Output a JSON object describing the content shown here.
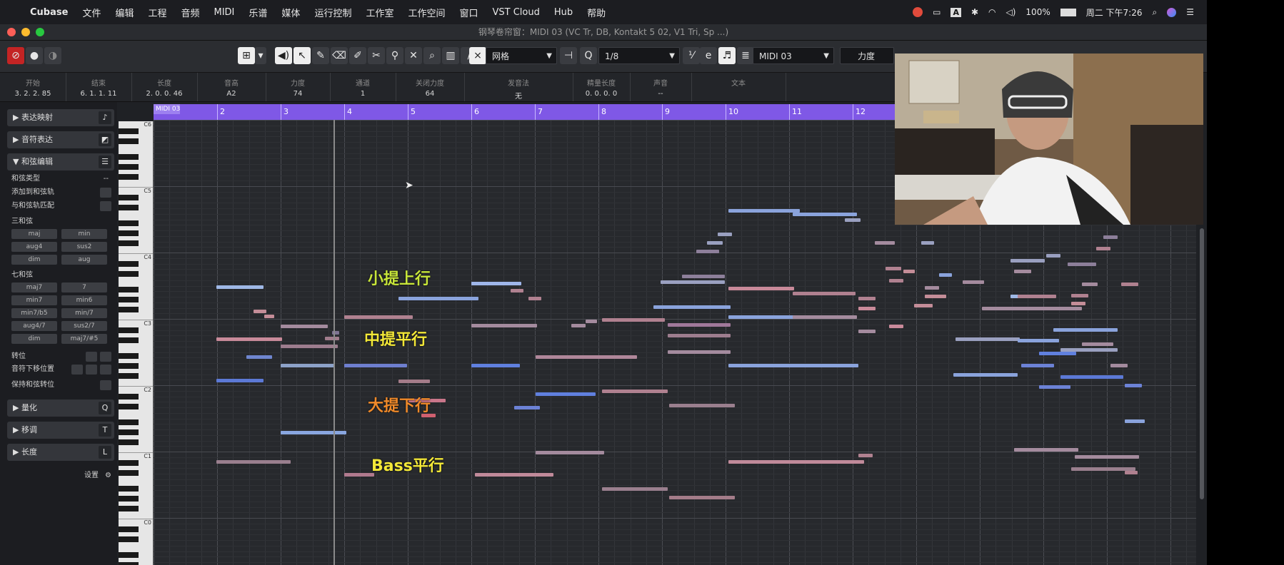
{
  "menubar": {
    "app": "Cubase",
    "items": [
      "文件",
      "编辑",
      "工程",
      "音频",
      "MIDI",
      "乐谱",
      "媒体",
      "运行控制",
      "工作室",
      "工作空间",
      "窗口",
      "VST Cloud",
      "Hub",
      "帮助"
    ],
    "battery": "100%",
    "clock": "周二 下午7:26"
  },
  "window": {
    "title": "钢琴卷帘窗：MIDI 03 (VC Tr, DB, Kontakt 5 02, V1 Tri, Sp ...)"
  },
  "toolbar": {
    "grid_type": "网格",
    "quantize": "1/8",
    "track": "MIDI 03",
    "controller": "力度"
  },
  "infoline": [
    {
      "label": "开始",
      "value": "3. 2. 2. 85"
    },
    {
      "label": "结束",
      "value": "6. 1. 1. 11"
    },
    {
      "label": "长度",
      "value": "2. 0. 0. 46"
    },
    {
      "label": "音高",
      "value": "A2"
    },
    {
      "label": "力度",
      "value": "74"
    },
    {
      "label": "通道",
      "value": "1"
    },
    {
      "label": "关闭力度",
      "value": "64"
    },
    {
      "label": "发音法",
      "value": "无"
    },
    {
      "label": "精量长度",
      "value": "0. 0. 0. 0"
    },
    {
      "label": "声音",
      "value": "--"
    },
    {
      "label": "文本",
      "value": ""
    }
  ],
  "inspector": {
    "expression_map": "表达映射",
    "note_expression": "音符表达",
    "chord_editing": "和弦编辑",
    "chord_type": "和弦类型",
    "add_to_chord_track": "添加到和弦轨",
    "match_to_chord_track": "与和弦轨匹配",
    "triads_title": "三和弦",
    "triads": [
      "maj",
      "min",
      "aug4",
      "sus2",
      "dim",
      "aug"
    ],
    "sevenths_title": "七和弦",
    "sevenths": [
      "maj7",
      "7",
      "min7",
      "min6",
      "min7/b5",
      "min/7",
      "aug4/7",
      "sus2/7",
      "dim",
      "maj7/#5"
    ],
    "inversion": "转位",
    "move_down": "音符下移位置",
    "hold_voicing": "保持和弦转位",
    "quantize": "量化",
    "transpose": "移调",
    "length": "长度",
    "settings": "设置"
  },
  "ruler": {
    "part_name": "MIDI 03",
    "bars": [
      "2",
      "3",
      "4",
      "5",
      "6",
      "7",
      "8",
      "9",
      "10",
      "11",
      "12"
    ]
  },
  "piano_octaves": [
    "C6",
    "C5",
    "C4",
    "C3",
    "C2",
    "C1",
    "C0"
  ],
  "annotations": [
    {
      "text": "小提上行",
      "color": "#c8e63a"
    },
    {
      "text": "中提平行",
      "color": "#f3e838"
    },
    {
      "text": "大提下行",
      "color": "#f08a2a"
    },
    {
      "text": "Bass平行",
      "color": "#f3e838"
    }
  ]
}
